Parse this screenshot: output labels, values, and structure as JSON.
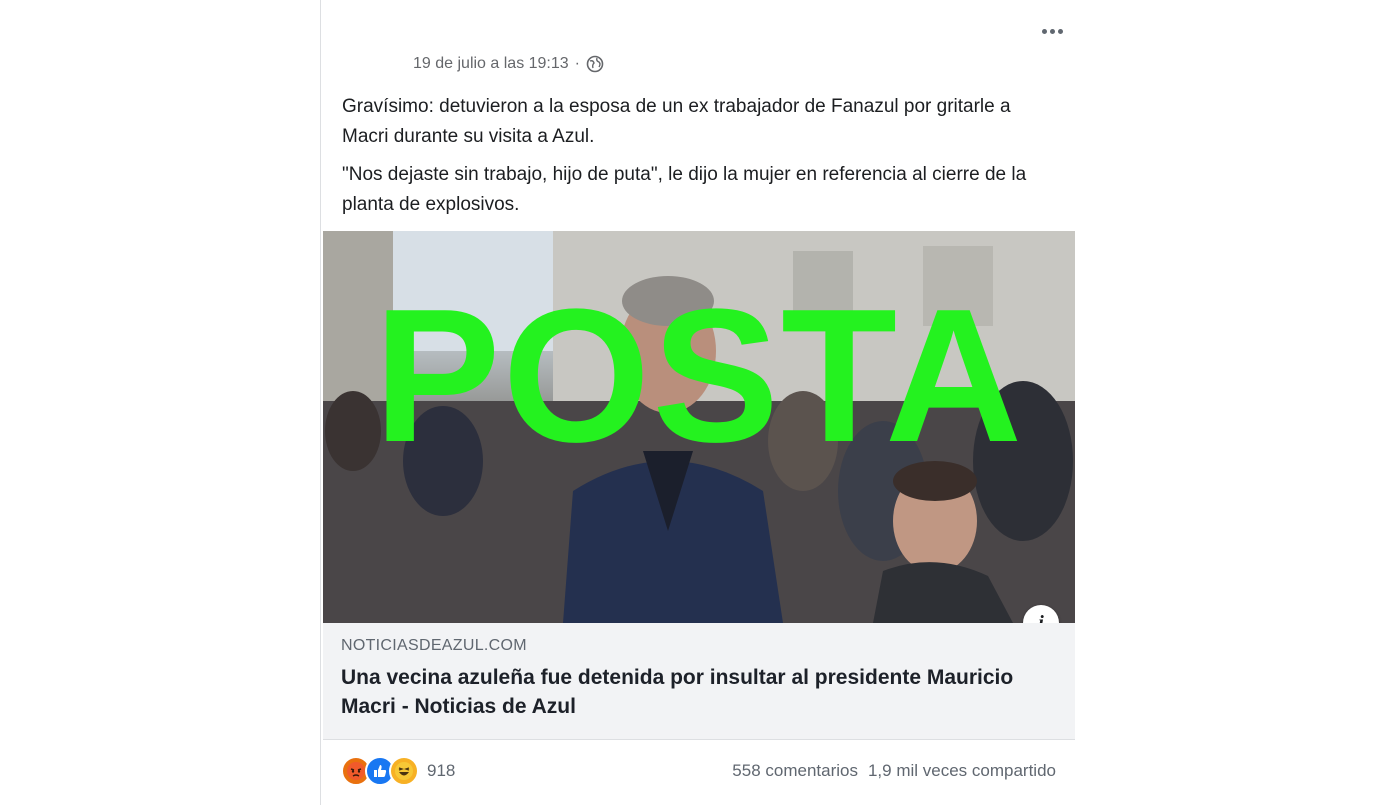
{
  "post": {
    "timestamp": "19 de julio a las 19:13",
    "separator": "·",
    "paragraphs": [
      "Gravísimo: detuvieron a la esposa de un ex trabajador de Fanazul por gritarle a Macri durante su visita a Azul.",
      "\"Nos dejaste sin trabajo, hijo de puta\", le dijo la mujer en referencia al cierre de la planta de explosivos."
    ]
  },
  "link_preview": {
    "overlay_stamp": "POSTA",
    "stamp_color": "#24f21f",
    "domain": "NOTICIASDEAZUL.COM",
    "headline": "Una vecina azuleña fue detenida por insultar al presidente Mauricio Macri - Noticias de Azul",
    "info_button": "i"
  },
  "footer": {
    "reaction_icons": [
      "angry-icon",
      "like-icon",
      "haha-icon"
    ],
    "reaction_count": "918",
    "comments": "558 comentarios",
    "shares": "1,9 mil veces compartido"
  },
  "colors": {
    "text_primary": "#1c1e21",
    "text_secondary": "#65676b",
    "caption_bg": "#f2f3f5",
    "like_blue": "#1877f2",
    "angry_red": "#e9710f",
    "haha_yellow": "#f7b125"
  }
}
